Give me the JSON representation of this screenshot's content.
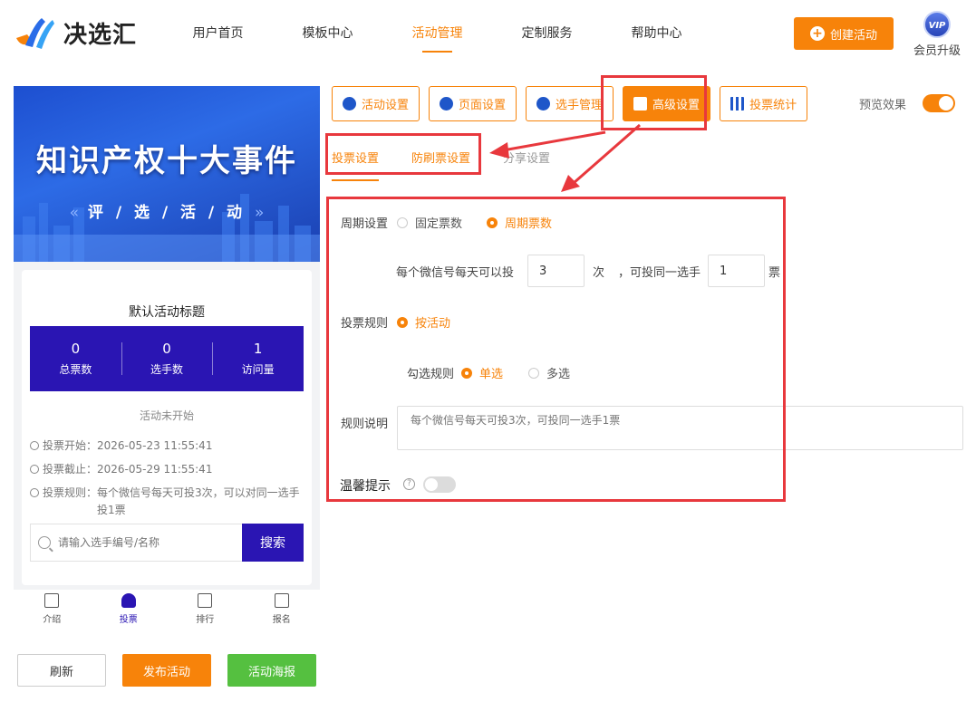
{
  "header": {
    "logo_text": "决选汇",
    "nav": [
      "用户首页",
      "模板中心",
      "活动管理",
      "定制服务",
      "帮助中心"
    ],
    "create_button": "创建活动",
    "vip_badge": "VIP",
    "vip_label": "会员升级"
  },
  "preview": {
    "banner_title": "知识产权十大事件",
    "banner_subtitle": "评 / 选 / 活 / 动",
    "banner_arrow_left": "«",
    "banner_arrow_right": "»",
    "activity_title": "默认活动标题",
    "stats": [
      {
        "value": "0",
        "label": "总票数"
      },
      {
        "value": "0",
        "label": "选手数"
      },
      {
        "value": "1",
        "label": "访问量"
      }
    ],
    "status": "活动未开始",
    "vote_start": "投票开始：2026-05-23 11:55:41",
    "vote_end": "投票截止：2026-05-29 11:55:41",
    "vote_rule_line1": "投票规则：每个微信号每天可投3次，可以对同一选手",
    "vote_rule_line2": "投1票",
    "search_placeholder": "请输入选手编号/名称",
    "search_button": "搜索",
    "tabs": [
      "介绍",
      "投票",
      "排行",
      "报名"
    ]
  },
  "actions": {
    "refresh": "刷新",
    "publish": "发布活动",
    "poster": "活动海报"
  },
  "settings": {
    "tabs": [
      "活动设置",
      "页面设置",
      "选手管理",
      "高级设置",
      "投票统计"
    ],
    "active_tab": "高级设置",
    "preview_label": "预览效果",
    "sub_tabs": [
      "投票设置",
      "防刷票设置",
      "分享设置"
    ],
    "period_label": "周期设置",
    "period_options": [
      "固定票数",
      "周期票数"
    ],
    "per_day_prefix": "每个微信号每天可以投",
    "per_day_value": "3",
    "times_unit": "次",
    "same_player_prefix": "，可投同一选手",
    "same_player_value": "1",
    "votes_unit": "票",
    "vote_rule_label": "投票规则",
    "vote_rule_option": "按活动",
    "select_rule_label": "勾选规则",
    "select_options": [
      "单选",
      "多选"
    ],
    "rule_desc_label": "规则说明",
    "rule_desc_placeholder": "每个微信号每天可投3次，可投同一选手1票",
    "tip_label": "温馨提示",
    "tip_help": "?"
  },
  "colors": {
    "accent": "#f7830a",
    "brand_purple": "#2a15b3",
    "highlight_red": "#e8383d",
    "green": "#55c040"
  }
}
